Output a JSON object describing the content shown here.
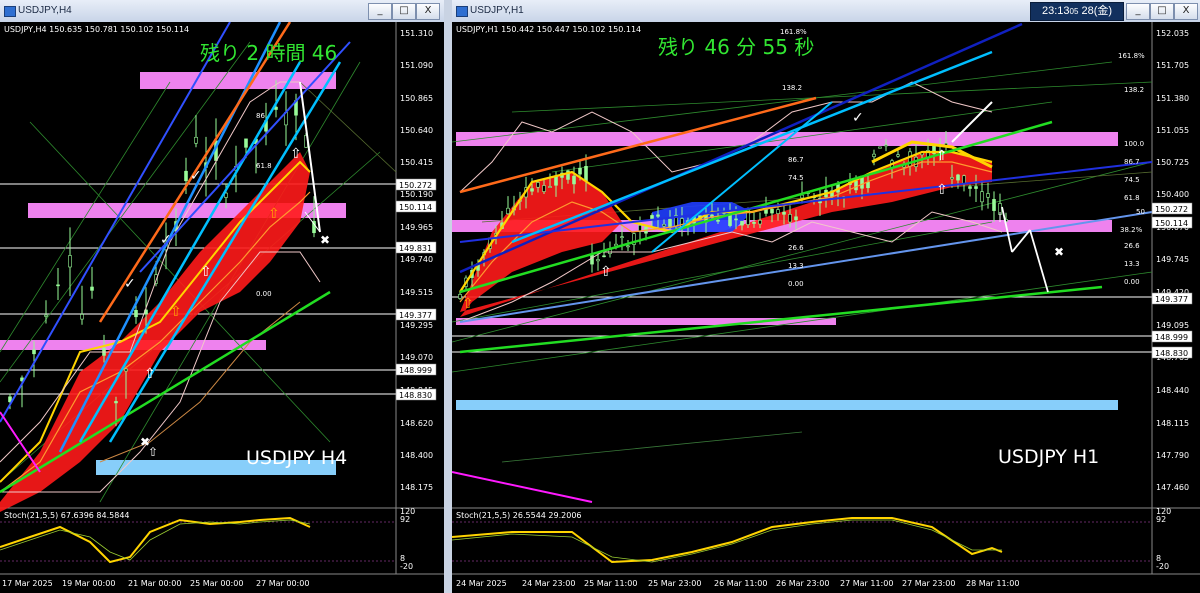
{
  "left": {
    "window_title": "USDJPY,H4",
    "info": "USDJPY,H4  150.635 150.781 150.102 150.114",
    "overlay_text": "残り  2 時間 46",
    "watermark": "USDJPY H4",
    "stoch_label": "Stoch(21,5,5) 67.6396 84.5844",
    "stoch_levels": [
      "120",
      "92",
      "8",
      "-20"
    ],
    "price_labels": [
      "151.310",
      "151.090",
      "150.865",
      "150.640",
      "150.415",
      "150.190",
      "149.965",
      "149.740",
      "149.515",
      "149.295",
      "149.070",
      "148.845",
      "148.620",
      "148.400",
      "148.175"
    ],
    "boxed_labels": [
      {
        "value": "150.272",
        "dark": false
      },
      {
        "value": "150.114",
        "dark": true
      },
      {
        "value": "149.831",
        "dark": false
      },
      {
        "value": "149.377",
        "dark": false
      },
      {
        "value": "148.999",
        "dark": false
      },
      {
        "value": "148.830",
        "dark": false
      }
    ],
    "fib_labels": [
      "86",
      "61.8",
      "0.00"
    ],
    "time_labels": [
      "17 Mar 2025",
      "19 Mar 00:00",
      "21 Mar 00:00",
      "25 Mar 00:00",
      "27 Mar 00:00"
    ]
  },
  "right": {
    "window_title": "USDJPY,H1",
    "info": "USDJPY,H1  150.442 150.447 150.102 150.114",
    "overlay_text": "残り  46  分  55  秒",
    "watermark": "USDJPY H1",
    "clock_time": "23:13",
    "clock_sec": "05",
    "clock_date": "28(金)",
    "stoch_label": "Stoch(21,5,5) 26.5544 29.2006",
    "stoch_levels": [
      "120",
      "92",
      "8",
      "-20"
    ],
    "price_labels": [
      "152.035",
      "151.705",
      "151.380",
      "151.055",
      "150.725",
      "150.400",
      "150.070",
      "149.745",
      "149.420",
      "149.095",
      "148.765",
      "148.440",
      "148.115",
      "147.790",
      "147.460"
    ],
    "boxed_labels": [
      {
        "value": "150.272",
        "dark": false
      },
      {
        "value": "150.114",
        "dark": true
      },
      {
        "value": "149.377",
        "dark": false
      },
      {
        "value": "148.999",
        "dark": false
      },
      {
        "value": "148.830",
        "dark": false
      }
    ],
    "fib_labels": [
      "161.8%",
      "138.2",
      "100.0",
      "86.7",
      "74.5",
      "61.8",
      "50",
      "38.2%",
      "26.6",
      "13.3",
      "0.00"
    ],
    "fib_labels_top": [
      "161.8%",
      "138.2",
      "86.7",
      "74.5",
      "26.6",
      "13.3",
      "0.00"
    ],
    "time_labels": [
      "24 Mar 2025",
      "24 Mar 23:00",
      "25 Mar 11:00",
      "25 Mar 23:00",
      "26 Mar 11:00",
      "26 Mar 23:00",
      "27 Mar 11:00",
      "27 Mar 23:00",
      "28 Mar 11:00"
    ]
  },
  "window_buttons": [
    "_",
    "□",
    "X"
  ],
  "colors": {
    "pink_zone": "#ee82ee",
    "blue_zone": "#87cefa",
    "overlay_green": "#32e632",
    "bull": "#98fb98",
    "bear": "#ff2020"
  }
}
